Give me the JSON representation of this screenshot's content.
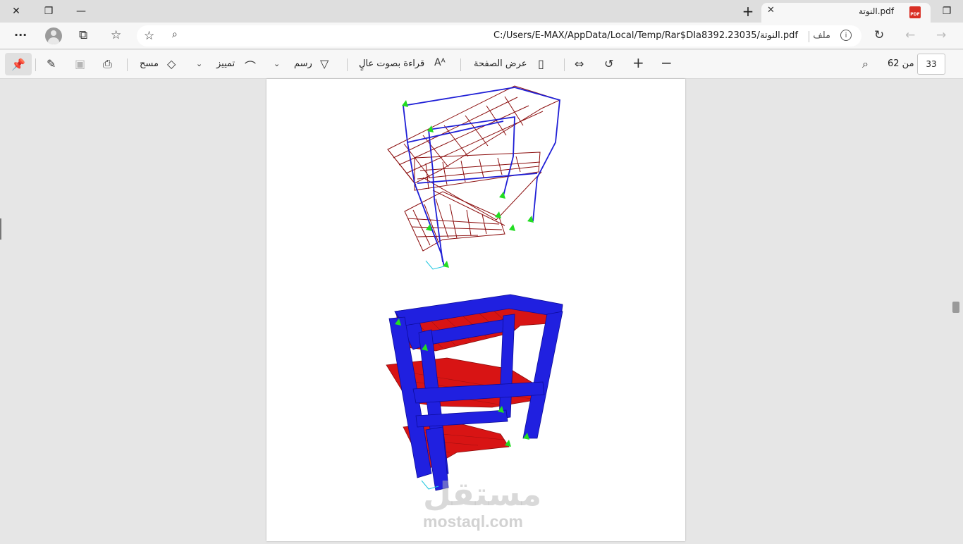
{
  "window": {
    "close_glyph": "✕",
    "restore_glyph": "❐",
    "minimize_glyph": "—",
    "new_tab_glyph": "+",
    "tab_actions_glyph": "❐"
  },
  "tab": {
    "title": "النوتة.pdf",
    "close_glyph": "✕",
    "badge": "PDF"
  },
  "address": {
    "url": "C:/Users/E-MAX/AppData/Local/Temp/Rar$DIa8392.23035/النوتة.pdf",
    "file_label": "ملف",
    "info_glyph": "i"
  },
  "toolbar": {
    "draw_label": "رسم",
    "highlight_label": "تمييز",
    "erase_label": "مسح",
    "read_aloud_label": "قراءة بصوت عالٍ",
    "page_view_label": "عرض الصفحة",
    "page_number": "33",
    "page_total_label": "من 62"
  },
  "document": {
    "watermark_logo": "مستقل",
    "watermark_text": "mostaql.com"
  },
  "colors": {
    "frame_blue": "#1f1fd6",
    "slab_red": "#8b0d0d",
    "solid_red": "#d81414",
    "support_green": "#22dd22"
  }
}
